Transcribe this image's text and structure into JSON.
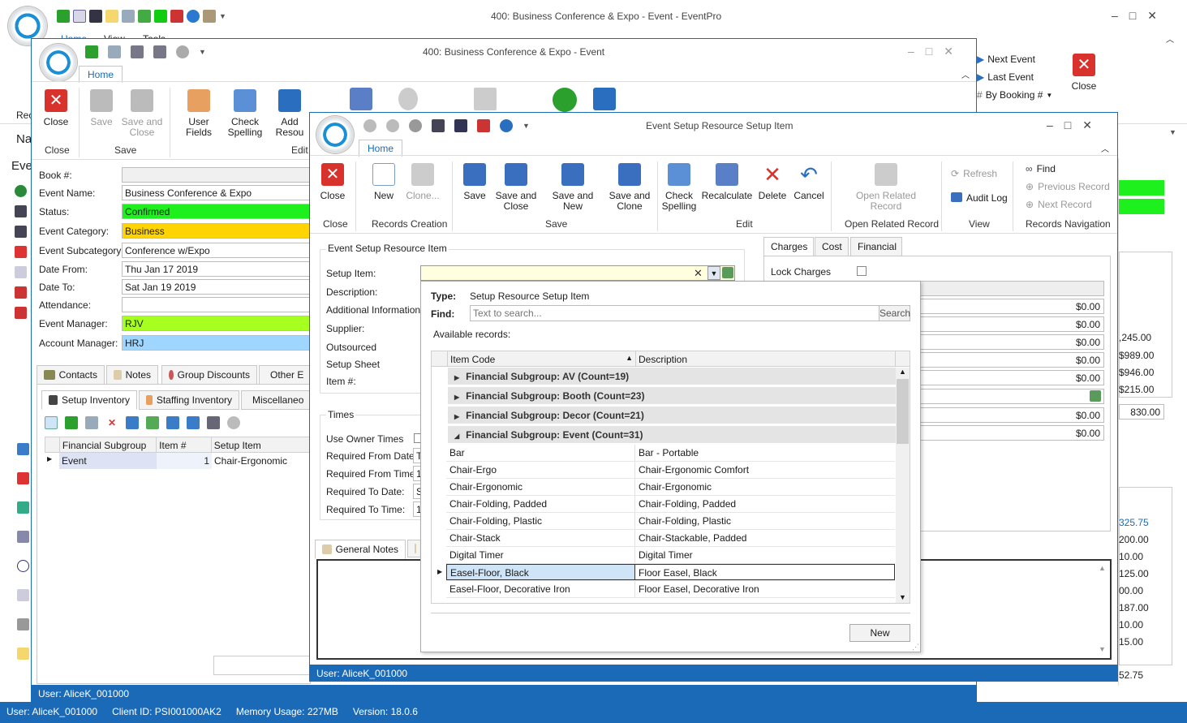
{
  "main_window": {
    "title": "400: Business Conference & Expo - Event - EventPro",
    "menu_tabs": [
      "Home",
      "View",
      "Tools"
    ],
    "right_nav": {
      "next_event": "Next Event",
      "last_event": "Last Event",
      "by_booking": "By Booking #",
      "close": "Close"
    },
    "left_cut": {
      "rec": "Rec",
      "na": "Na",
      "eve": "Eve"
    }
  },
  "event_window": {
    "title": "400: Business Conference & Expo - Event",
    "home_tab": "Home",
    "ribbon": {
      "close": "Close",
      "save": "Save",
      "save_and_close": "Save and Close",
      "user_fields": "User Fields",
      "check_spelling": "Check Spelling",
      "add_resource": "Add Resou",
      "groups": {
        "close": "Close",
        "save": "Save",
        "edit": "Edit"
      }
    },
    "form": {
      "book_label": "Book #:",
      "book_value": "",
      "name_label": "Event Name:",
      "name_value": "Business Conference & Expo",
      "status_label": "Status:",
      "status_value": "Confirmed",
      "category_label": "Event Category:",
      "category_value": "Business",
      "subcategory_label": "Event Subcategory:",
      "subcategory_value": "Conference w/Expo",
      "date_from_label": "Date From:",
      "date_from_value": "Thu Jan 17 2019",
      "date_to_label": "Date To:",
      "date_to_value": "Sat Jan 19 2019",
      "attendance_label": "Attendance:",
      "attendance_value": "",
      "manager_label": "Event Manager:",
      "manager_value": "RJV",
      "account_label": "Account Manager:",
      "account_value": "HRJ"
    },
    "tabs": [
      "Contacts",
      "Notes",
      "Group Discounts",
      "Other E"
    ],
    "subtabs": [
      "Setup Inventory",
      "Staffing Inventory",
      "Miscellaneo"
    ],
    "grid": {
      "headers": [
        "Financial Subgroup",
        "Item #",
        "Setup Item"
      ],
      "row": {
        "subgroup": "Event",
        "item_no": "1",
        "setup_item": "Chair-Ergonomic"
      }
    },
    "status_user": "User: AliceK_001000"
  },
  "setup_window": {
    "title": "Event Setup Resource Setup Item",
    "home_tab": "Home",
    "ribbon": {
      "close": "Close",
      "new": "New",
      "clone": "Clone...",
      "save": "Save",
      "save_and_close": "Save and Close",
      "save_and_new": "Save and New",
      "save_and_clone": "Save and Clone",
      "check_spelling": "Check Spelling",
      "recalculate": "Recalculate",
      "delete": "Delete",
      "cancel": "Cancel",
      "open_related": "Open Related Record",
      "refresh": "Refresh",
      "audit_log": "Audit Log",
      "find": "Find",
      "previous_record": "Previous Record",
      "next_record": "Next Record",
      "groups": {
        "close": "Close",
        "records_creation": "Records Creation",
        "save": "Save",
        "edit": "Edit",
        "open_related": "Open Related Record",
        "view": "View",
        "records_navigation": "Records Navigation"
      }
    },
    "section_title": "Event Setup Resource Item",
    "labels": {
      "setup_item": "Setup Item:",
      "description": "Description:",
      "additional_info": "Additional Information:",
      "supplier": "Supplier:",
      "outsourced": "Outsourced",
      "setup_sheet": "Setup Sheet",
      "item_no": "Item #:"
    },
    "times": {
      "title": "Times",
      "use_owner": "Use Owner Times",
      "req_from_date": "Required From Date:",
      "req_from_time": "Required From Time:",
      "req_to_date": "Required To Date:",
      "req_to_time": "Required To Time:",
      "from_date_value": "T",
      "from_time_value": "1",
      "to_date_value": "S",
      "to_time_value": "1"
    },
    "notes_tab": "General Notes",
    "right_tabs": [
      "Charges",
      "Cost",
      "Financial"
    ],
    "lock_charges": "Lock Charges",
    "prices": [
      "$0.00",
      "$0.00",
      "$0.00",
      "$0.00",
      "$0.00",
      "$0.00",
      "$0.00"
    ],
    "status_user": "User: AliceK_001000"
  },
  "lookup": {
    "type_label": "Type:",
    "type_value": "Setup Resource Setup Item",
    "find_label": "Find:",
    "search_placeholder": "Text to search...",
    "search_button": "Search",
    "available": "Available records:",
    "headers": [
      "Item Code",
      "Description"
    ],
    "groups": [
      "Financial Subgroup: AV (Count=19)",
      "Financial Subgroup: Booth (Count=23)",
      "Financial Subgroup: Decor (Count=21)",
      "Financial Subgroup: Event (Count=31)"
    ],
    "rows": [
      {
        "code": "Bar",
        "desc": "Bar - Portable"
      },
      {
        "code": "Chair-Ergo",
        "desc": "Chair-Ergonomic Comfort"
      },
      {
        "code": "Chair-Ergonomic",
        "desc": "Chair-Ergonomic"
      },
      {
        "code": "Chair-Folding, Padded",
        "desc": "Chair-Folding, Padded"
      },
      {
        "code": "Chair-Folding, Plastic",
        "desc": "Chair-Folding, Plastic"
      },
      {
        "code": "Chair-Stack",
        "desc": "Chair-Stackable, Padded"
      },
      {
        "code": "Digital Timer",
        "desc": "Digital Timer"
      },
      {
        "code": "Easel-Floor, Black",
        "desc": "Floor Easel, Black"
      },
      {
        "code": "Easel-Floor, Decorative Iron",
        "desc": "Floor Easel, Decorative Iron"
      }
    ],
    "new_button": "New"
  },
  "background_values": {
    "v1": ",245.00",
    "v2": "$989.00",
    "v3": "$946.00",
    "v4": "$215.00",
    "v5": "830.00",
    "v6": "325.75",
    "v7": "200.00",
    "v8": "10.00",
    "v9": "125.00",
    "v10": "00.00",
    "v11": "187.00",
    "v12": "10.00",
    "v13": "15.00",
    "v14": "52.75"
  },
  "bottom_status": {
    "user": "User: AliceK_001000",
    "client": "Client ID: PSI001000AK2",
    "memory": "Memory Usage: 227MB",
    "version": "Version: 18.0.6"
  },
  "colors": {
    "confirmed": "#1ef01e",
    "business": "#ffd400",
    "rjv": "#a6ff1e",
    "hrj": "#9fd6ff",
    "accent": "#1a6ab8"
  }
}
